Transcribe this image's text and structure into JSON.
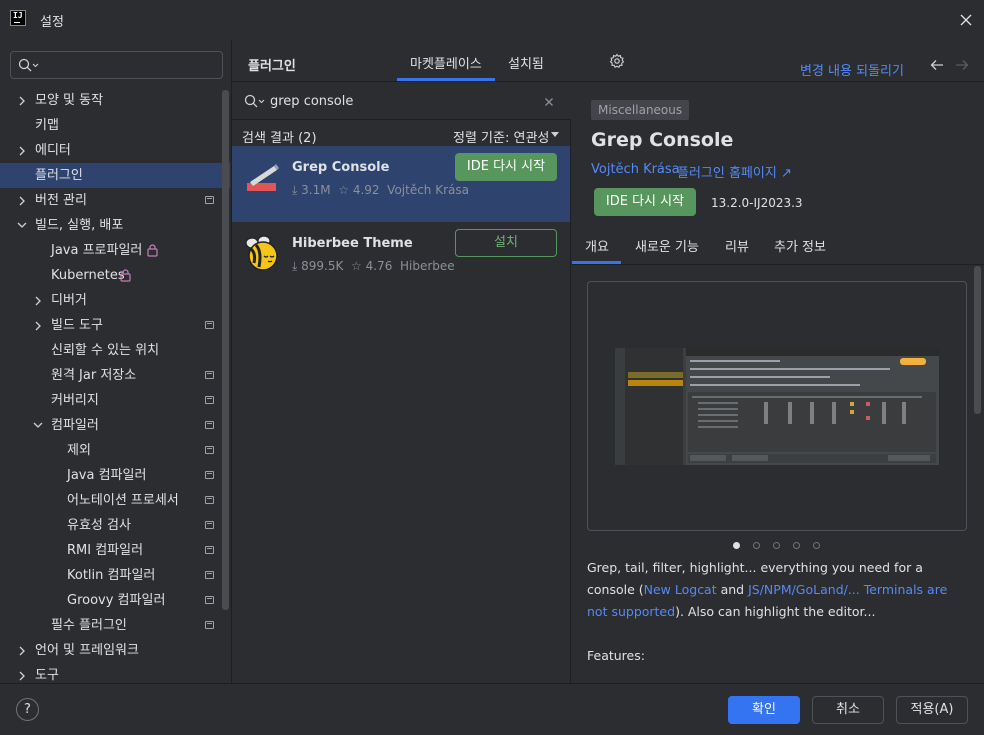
{
  "window": {
    "title": "설정",
    "app_icon_text": "IJ"
  },
  "sidebar": {
    "search_placeholder": "",
    "items": [
      {
        "label": "모양 및 동작"
      },
      {
        "label": "키맵"
      },
      {
        "label": "에디터"
      },
      {
        "label": "플러그인"
      },
      {
        "label": "버전 관리"
      },
      {
        "label": "빌드, 실행, 배포"
      },
      {
        "label": "Java 프로파일러"
      },
      {
        "label": "Kubernetes"
      },
      {
        "label": "디버거"
      },
      {
        "label": "빌드 도구"
      },
      {
        "label": "신뢰할 수 있는 위치"
      },
      {
        "label": "원격 Jar 저장소"
      },
      {
        "label": "커버리지"
      },
      {
        "label": "컴파일러"
      },
      {
        "label": "제외"
      },
      {
        "label": "Java 컴파일러"
      },
      {
        "label": "어노테이션 프로세서"
      },
      {
        "label": "유효성 검사"
      },
      {
        "label": "RMI 컴파일러"
      },
      {
        "label": "Kotlin 컴파일러"
      },
      {
        "label": "Groovy 컴파일러"
      },
      {
        "label": "필수 플러그인"
      },
      {
        "label": "언어 및 프레임워크"
      },
      {
        "label": "도구"
      }
    ]
  },
  "header": {
    "title": "플러그인",
    "tabs": [
      {
        "label": "마켓플레이스"
      },
      {
        "label": "설치됨"
      }
    ],
    "revert_label": "변경 내용 되돌리기"
  },
  "plugin_list": {
    "search_value": "grep console",
    "results_label": "검색 결과 (2)",
    "sort_label": "정렬 기준: 연관성",
    "plugins": [
      {
        "name": "Grep Console",
        "downloads": "3.1M",
        "rating": "4.92",
        "vendor": "Vojtěch Krása",
        "action": "IDE 다시 시작"
      },
      {
        "name": "Hiberbee Theme",
        "downloads": "899.5K",
        "rating": "4.76",
        "vendor": "Hiberbee",
        "action": "설치"
      }
    ]
  },
  "detail": {
    "category": "Miscellaneous",
    "name": "Grep Console",
    "vendor": "Vojtěch Krása",
    "homepage": "플러그인 홈페이지 ↗",
    "restart_label": "IDE 다시 시작",
    "version": "13.2.0-IJ2023.3",
    "tabs": [
      {
        "label": "개요"
      },
      {
        "label": "새로운 기능"
      },
      {
        "label": "리뷰"
      },
      {
        "label": "추가 정보"
      }
    ],
    "carousel": {
      "total": 5,
      "active": 1
    },
    "desc_1": "Grep, tail, filter, highlight... everything you need for a console (",
    "desc_link_1": "New Logcat",
    "desc_2": " and ",
    "desc_link_2": "JS/NPM/GoLand/... Terminals are not supported",
    "desc_3": "). Also can highlight the editor...",
    "features_label": "Features:"
  },
  "footer": {
    "help_label": "?",
    "ok_label": "확인",
    "cancel_label": "취소",
    "apply_label": "적용(A)"
  },
  "colors": {
    "accent": "#3574f0",
    "selection": "#2e436e",
    "green_button": "#57965c",
    "link": "#548af7",
    "background": "#2b2d30"
  }
}
